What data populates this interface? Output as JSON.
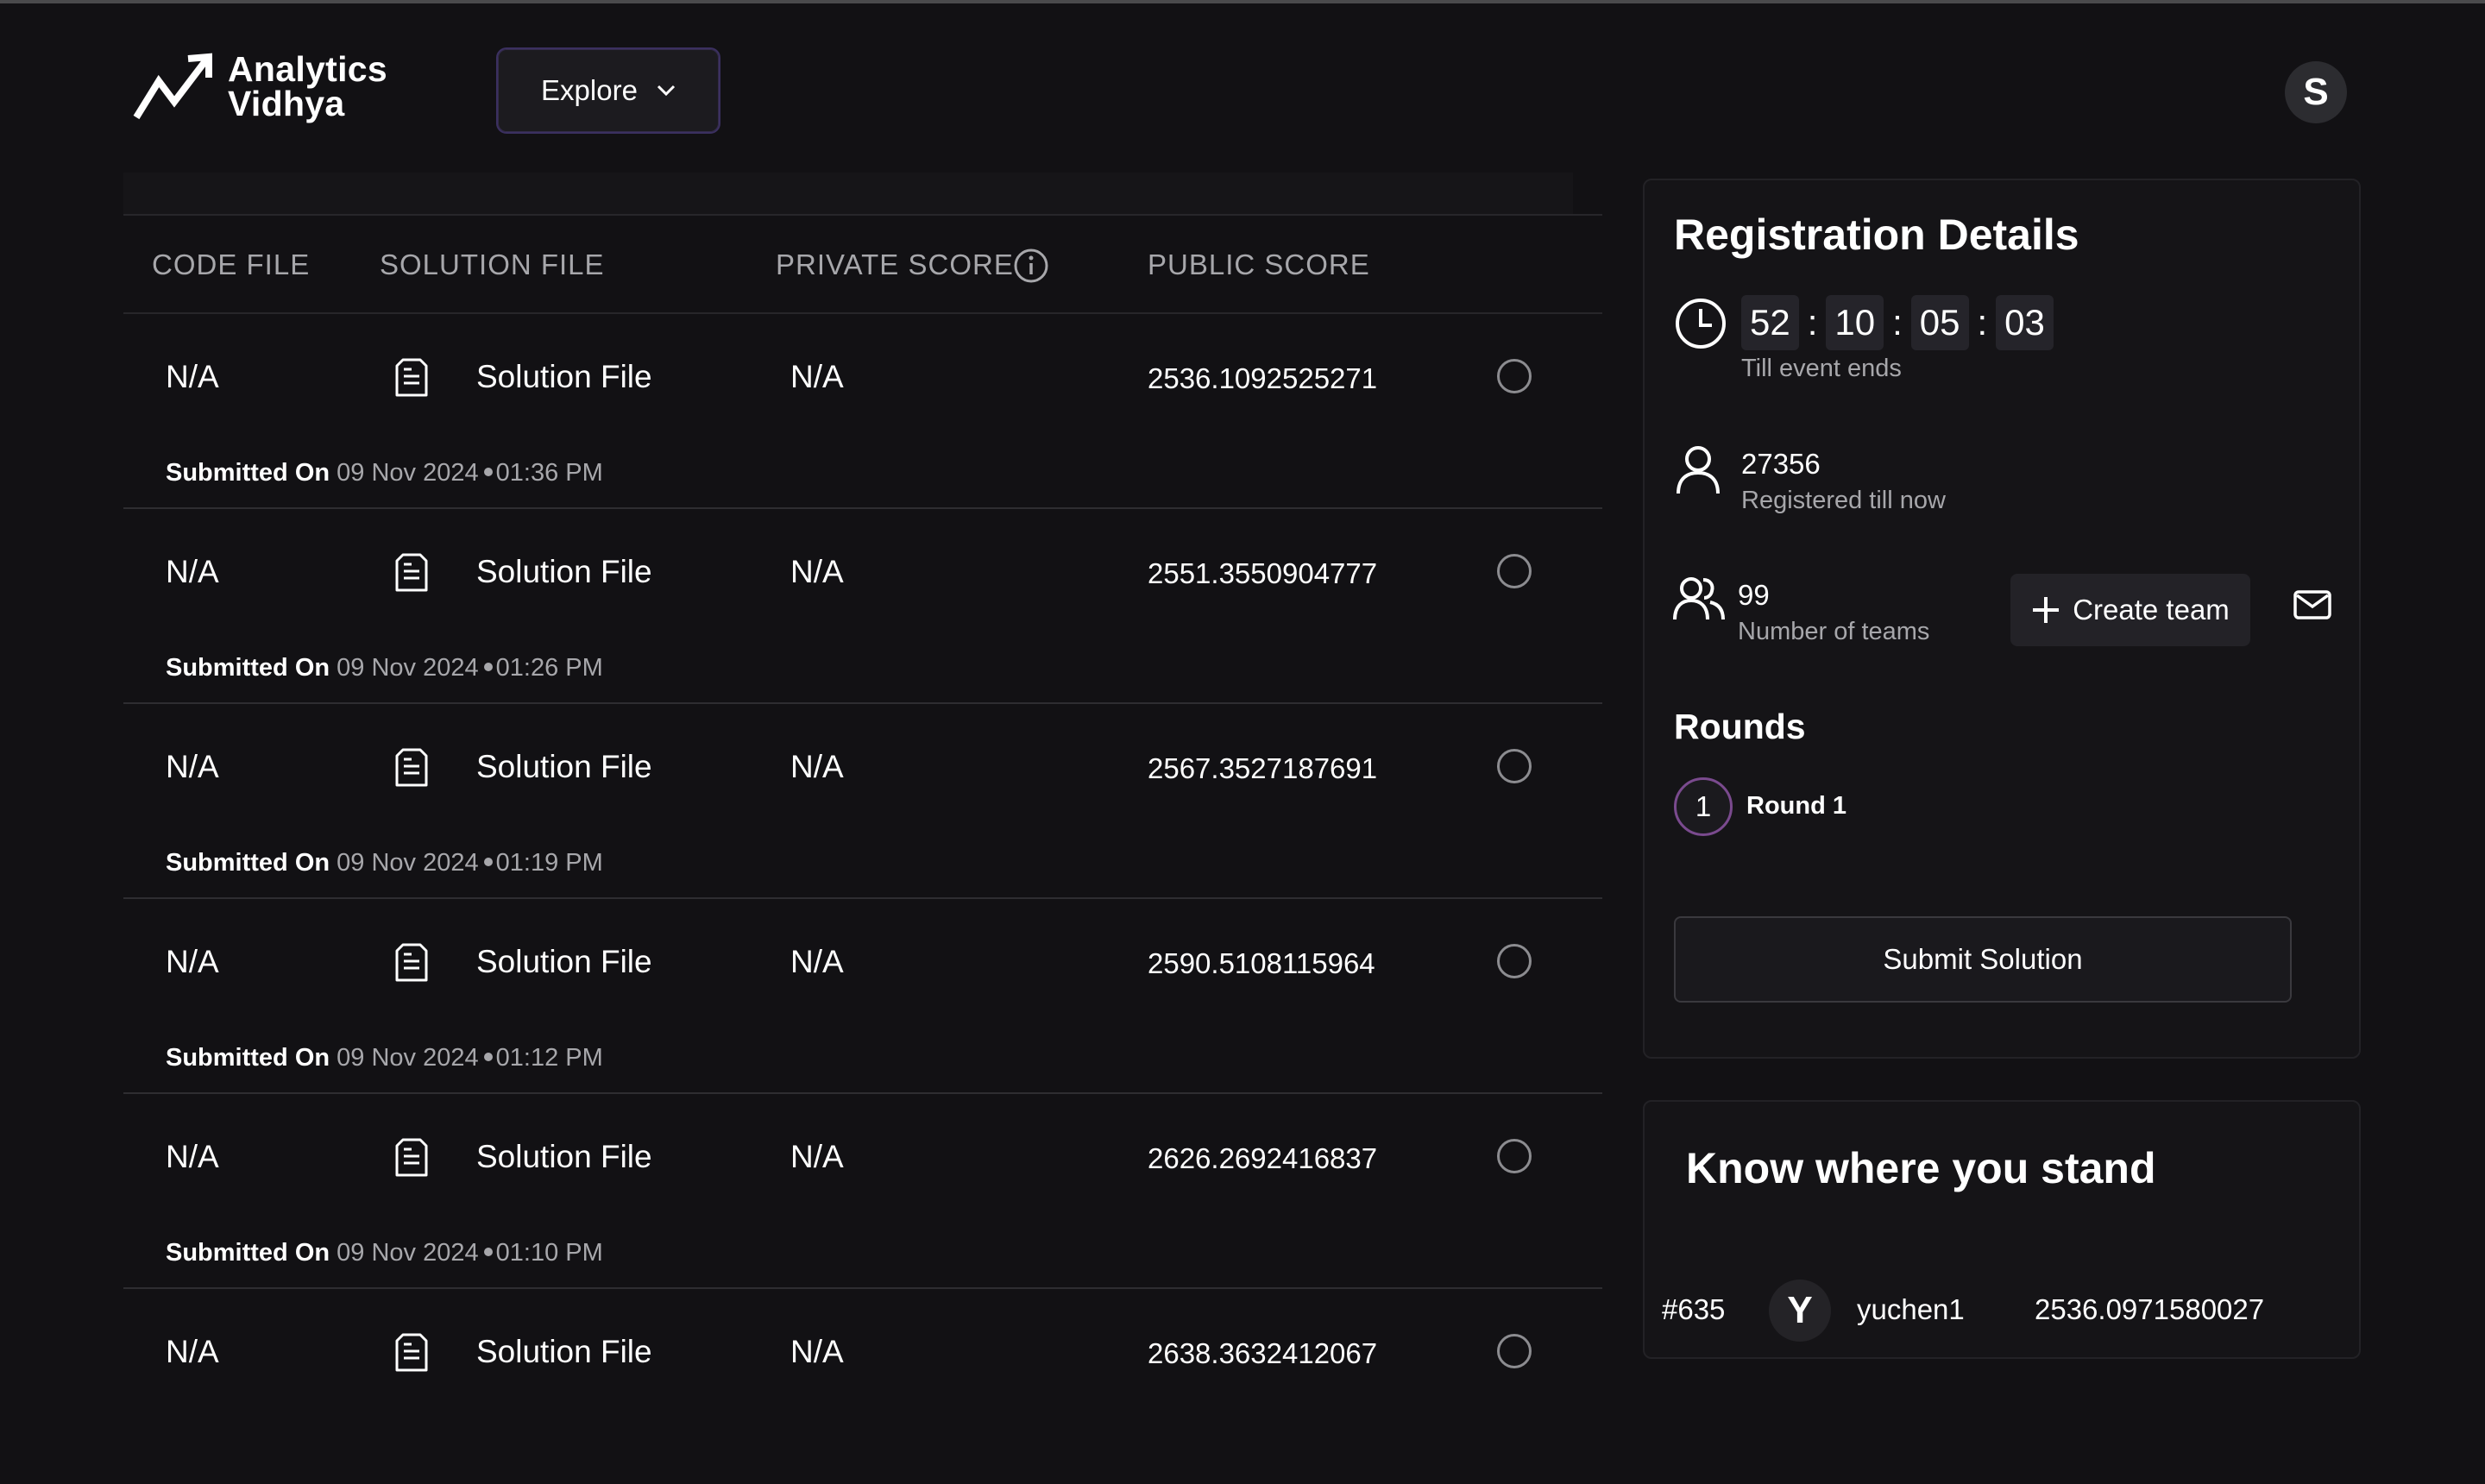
{
  "brand": {
    "line1": "Analytics",
    "line2": "Vidhya"
  },
  "header": {
    "explore_label": "Explore",
    "avatar_initial": "S"
  },
  "table": {
    "columns": [
      "CODE FILE",
      "SOLUTION FILE",
      "PRIVATE SCORE",
      "PUBLIC SCORE"
    ],
    "rows": [
      {
        "code_file": "N/A",
        "solution_file": "Solution File",
        "private_score": "N/A",
        "public_score": "2536.1092525271",
        "submitted_label": "Submitted On",
        "date": "09 Nov 2024",
        "time": "01:36 PM"
      },
      {
        "code_file": "N/A",
        "solution_file": "Solution File",
        "private_score": "N/A",
        "public_score": "2551.3550904777",
        "submitted_label": "Submitted On",
        "date": "09 Nov 2024",
        "time": "01:26 PM"
      },
      {
        "code_file": "N/A",
        "solution_file": "Solution File",
        "private_score": "N/A",
        "public_score": "2567.3527187691",
        "submitted_label": "Submitted On",
        "date": "09 Nov 2024",
        "time": "01:19 PM"
      },
      {
        "code_file": "N/A",
        "solution_file": "Solution File",
        "private_score": "N/A",
        "public_score": "2590.5108115964",
        "submitted_label": "Submitted On",
        "date": "09 Nov 2024",
        "time": "01:12 PM"
      },
      {
        "code_file": "N/A",
        "solution_file": "Solution File",
        "private_score": "N/A",
        "public_score": "2626.2692416837",
        "submitted_label": "Submitted On",
        "date": "09 Nov 2024",
        "time": "01:10 PM"
      },
      {
        "code_file": "N/A",
        "solution_file": "Solution File",
        "private_score": "N/A",
        "public_score": "2638.3632412067",
        "submitted_label": "",
        "date": "",
        "time": ""
      }
    ]
  },
  "registration": {
    "title": "Registration Details",
    "timer": {
      "hours": "52",
      "minutes": "10",
      "seconds": "05",
      "extra": "03",
      "sep": ":"
    },
    "timer_label": "Till event ends",
    "registered_count": "27356",
    "registered_label": "Registered till now",
    "teams_count": "99",
    "teams_label": "Number of teams",
    "create_team_label": "Create team",
    "rounds_title": "Rounds",
    "round_number": "1",
    "round_name": "Round 1",
    "submit_label": "Submit Solution"
  },
  "standing": {
    "title": "Know where you stand",
    "rank": "#635",
    "avatar_initial": "Y",
    "username": "yuchen1",
    "score": "2536.0971580027"
  }
}
